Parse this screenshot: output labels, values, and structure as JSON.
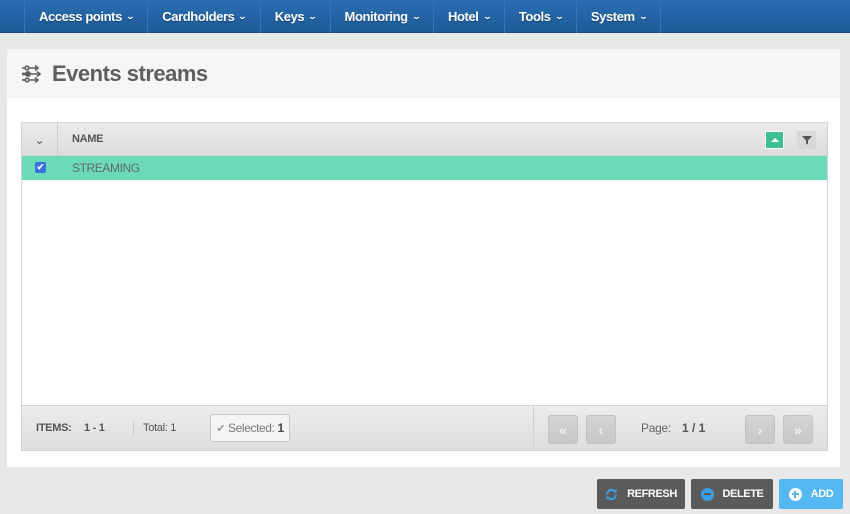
{
  "nav": {
    "items": [
      {
        "label": "Access points"
      },
      {
        "label": "Cardholders"
      },
      {
        "label": "Keys"
      },
      {
        "label": "Monitoring"
      },
      {
        "label": "Hotel"
      },
      {
        "label": "Tools"
      },
      {
        "label": "System"
      }
    ],
    "chevron": "⌄"
  },
  "page": {
    "title": "Events streams",
    "icon": "events-stream-icon"
  },
  "grid": {
    "toggle_glyph": "⌄",
    "columns": [
      {
        "label": "NAME"
      }
    ],
    "rows": [
      {
        "name": "STREAMING",
        "checked": true,
        "selected": true
      }
    ],
    "check_glyph": "✔",
    "colors": {
      "selected_row": "#6cd9b8",
      "sort_button": "#3fbf94",
      "checkbox": "#3a6fe0"
    }
  },
  "footer": {
    "items_label": "ITEMS:",
    "items_range": "1 - 1",
    "total_label": "Total: 1",
    "selected_check": "✔",
    "selected_label": "Selected:",
    "selected_count": "1",
    "page_label": "Page:",
    "page_value": "1 / 1",
    "first_glyph": "«",
    "prev_glyph": "‹",
    "next_glyph": "›",
    "last_glyph": "»"
  },
  "actions": {
    "refresh_label": "REFRESH",
    "delete_label": "DELETE",
    "add_label": "ADD",
    "colors": {
      "dark": "#5a5a5a",
      "add": "#55b8f2",
      "icon_blue": "#3aa0e6"
    }
  }
}
